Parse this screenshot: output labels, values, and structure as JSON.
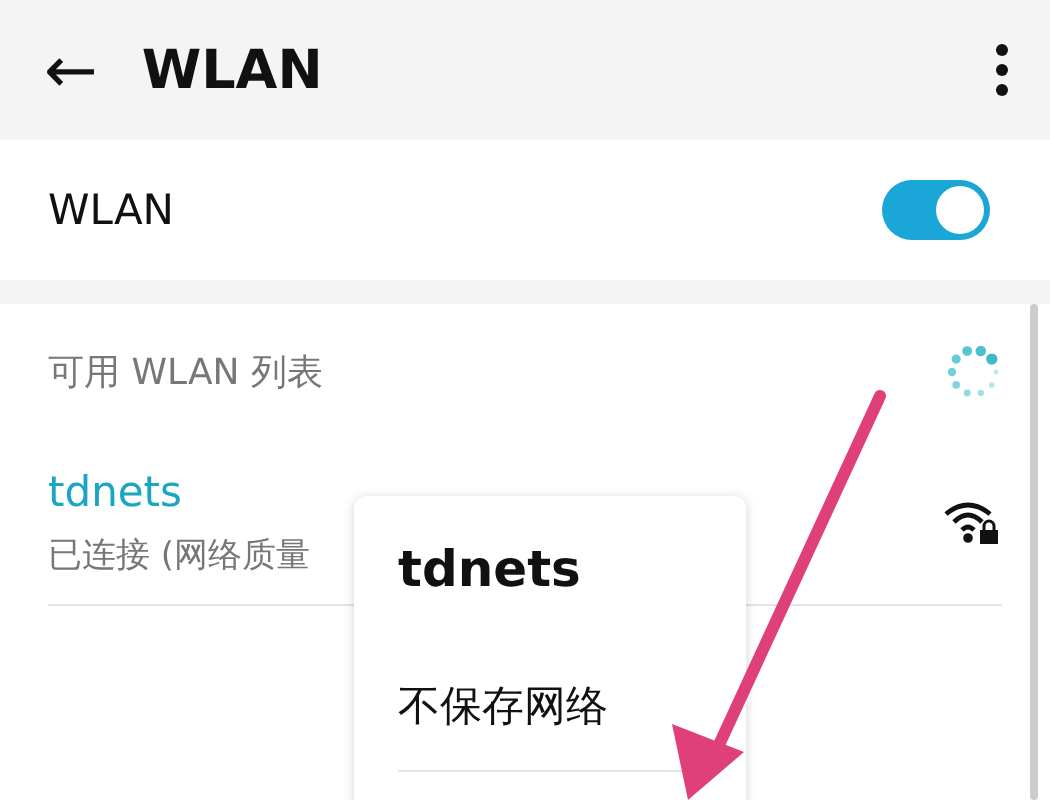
{
  "header": {
    "back": "←",
    "title": "WLAN"
  },
  "wlan_switch": {
    "label": "WLAN",
    "on": true
  },
  "section": {
    "title": "可用 WLAN 列表"
  },
  "networks": [
    {
      "name": "tdnets",
      "status": "已连接 (网络质量",
      "connected": true
    }
  ],
  "popup": {
    "title": "tdnets",
    "items": [
      "不保存网络"
    ]
  }
}
